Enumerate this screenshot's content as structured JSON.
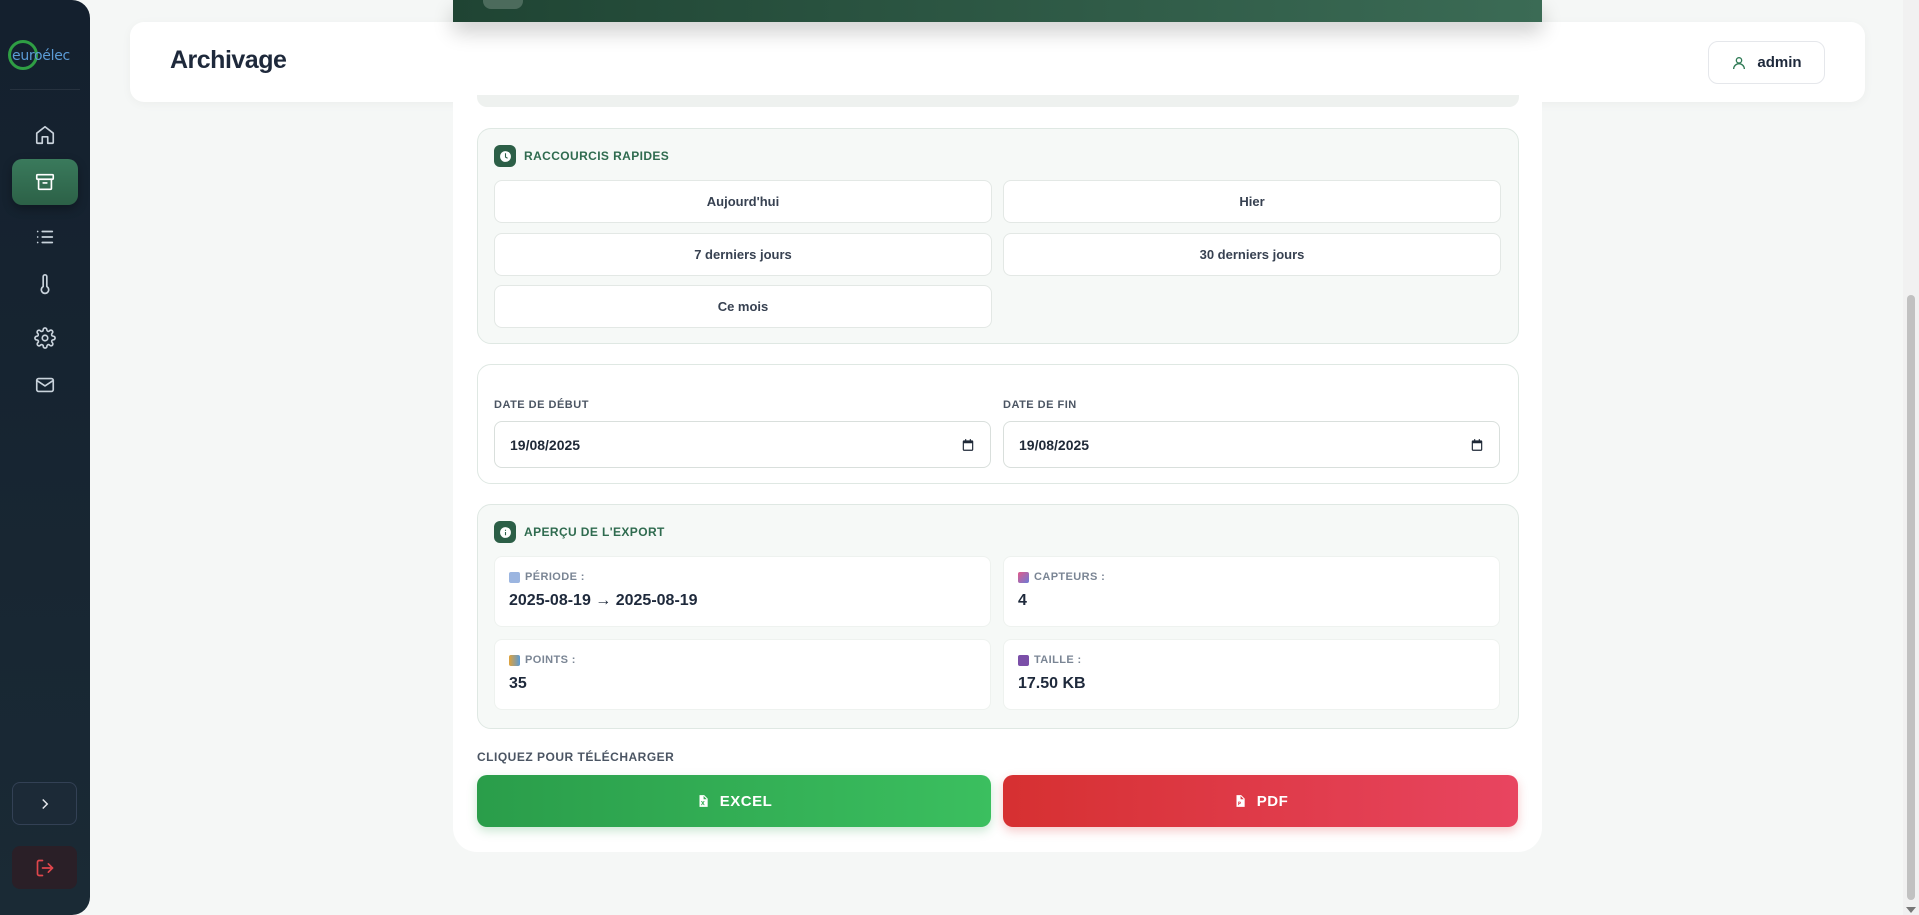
{
  "app": {
    "logo_text": "euroélec"
  },
  "sidebar": {
    "items": [
      {
        "name": "home",
        "icon": "home-icon"
      },
      {
        "name": "archive",
        "icon": "archive-icon",
        "active": true
      },
      {
        "name": "list",
        "icon": "list-icon"
      },
      {
        "name": "temperature",
        "icon": "thermometer-icon"
      },
      {
        "name": "settings",
        "icon": "gear-icon"
      },
      {
        "name": "mail",
        "icon": "mail-icon"
      }
    ],
    "expand_icon": "chevron-right-icon",
    "logout_icon": "logout-icon"
  },
  "header": {
    "title": "Archivage",
    "user_label": "admin",
    "user_icon": "user-icon"
  },
  "shortcuts": {
    "title": "Raccourcis rapides",
    "icon": "clock-icon",
    "items": [
      "Aujourd'hui",
      "Hier",
      "7 derniers jours",
      "30 derniers jours",
      "Ce mois"
    ]
  },
  "dates": {
    "start_label": "DATE DE DÉBUT",
    "start_value": "19/08/2025",
    "end_label": "DATE DE FIN",
    "end_value": "19/08/2025",
    "calendar_icon": "calendar-icon"
  },
  "preview": {
    "title": "Aperçu de l'export",
    "icon": "info-icon",
    "stats": [
      {
        "label": "PÉRIODE :",
        "value": "2025-08-19 → 2025-08-19",
        "icon": "calendar-emoji-icon"
      },
      {
        "label": "CAPTEURS :",
        "value": "4",
        "icon": "thermometer-emoji-icon"
      },
      {
        "label": "POINTS :",
        "value": "35",
        "icon": "chart-emoji-icon"
      },
      {
        "label": "TAILLE :",
        "value": "17.50 KB",
        "icon": "floppy-emoji-icon"
      }
    ]
  },
  "download": {
    "label": "CLIQUEZ POUR TÉLÉCHARGER",
    "excel_label": "EXCEL",
    "pdf_label": "PDF"
  },
  "colors": {
    "accent": "#2c5f47",
    "excel": "#2a9d4a",
    "pdf": "#d63031",
    "sidebar_bg": "#14202e"
  }
}
